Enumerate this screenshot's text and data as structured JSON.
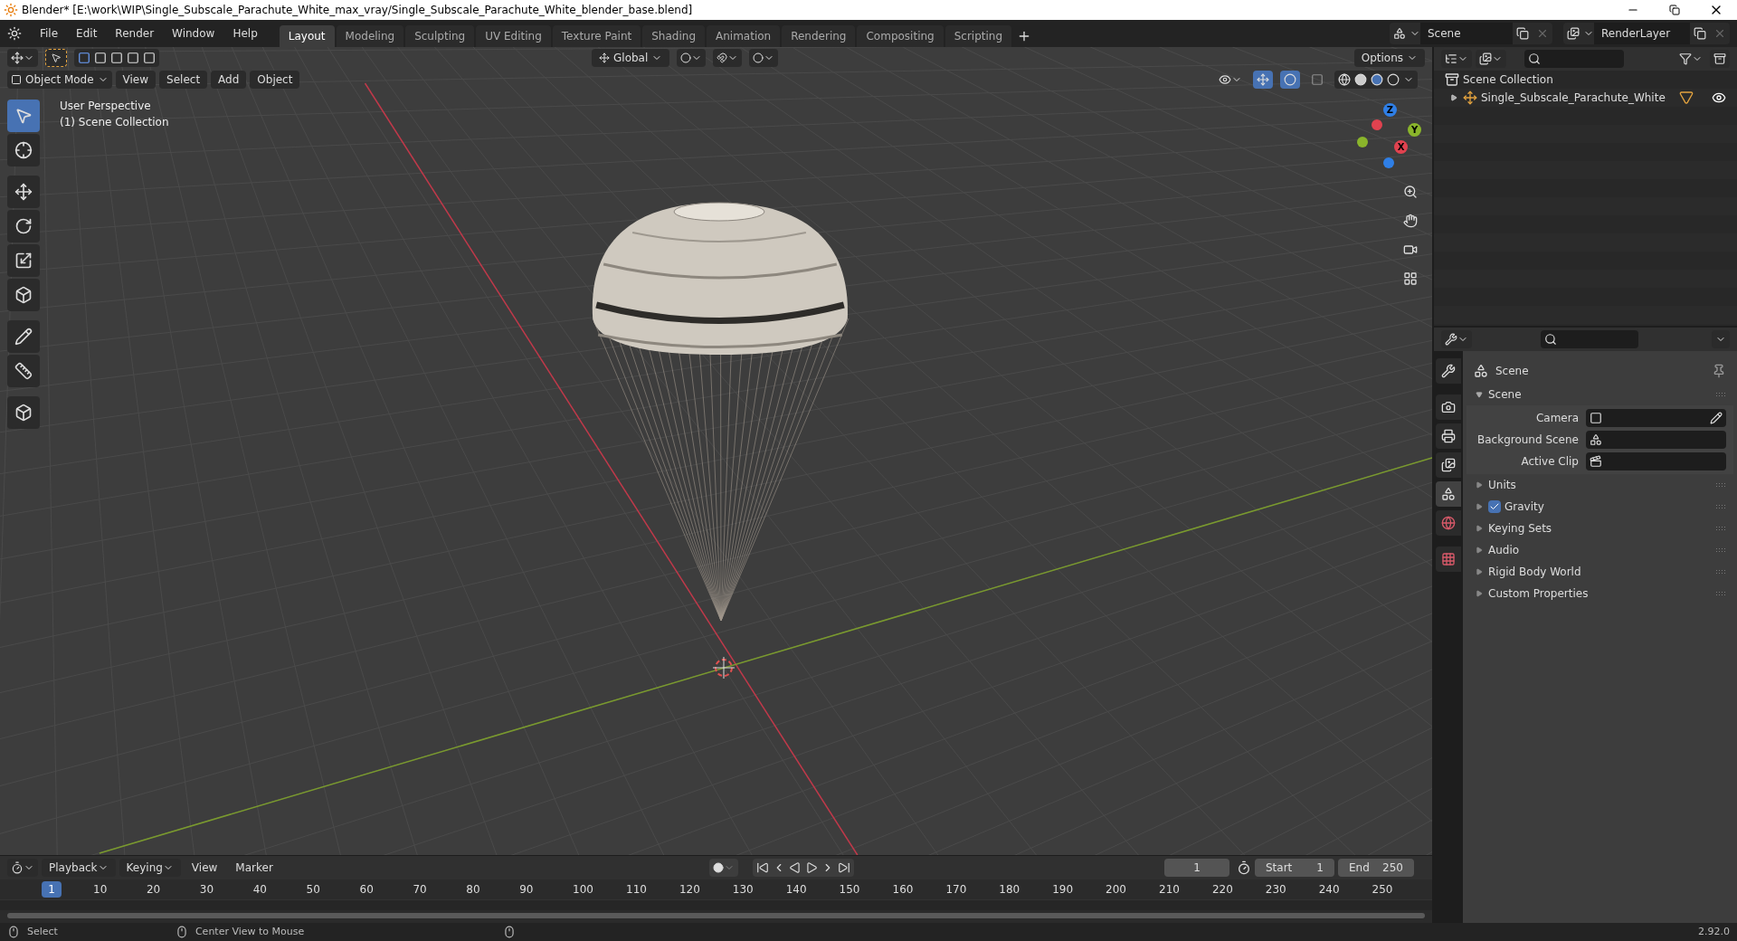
{
  "window": {
    "title": "Blender* [E:\\work\\WIP\\Single_Subscale_Parachute_White_max_vray/Single_Subscale_Parachute_White_blender_base.blend]"
  },
  "menu": [
    "File",
    "Edit",
    "Render",
    "Window",
    "Help"
  ],
  "workspaces": [
    {
      "label": "Layout",
      "selected": true
    },
    {
      "label": "Modeling",
      "selected": false
    },
    {
      "label": "Sculpting",
      "selected": false
    },
    {
      "label": "UV Editing",
      "selected": false
    },
    {
      "label": "Texture Paint",
      "selected": false
    },
    {
      "label": "Shading",
      "selected": false
    },
    {
      "label": "Animation",
      "selected": false
    },
    {
      "label": "Rendering",
      "selected": false
    },
    {
      "label": "Compositing",
      "selected": false
    },
    {
      "label": "Scripting",
      "selected": false
    }
  ],
  "scene_selector": {
    "value": "Scene"
  },
  "view_layer_selector": {
    "value": "RenderLayer"
  },
  "tool_header": {
    "orientation": "Global",
    "options": "Options"
  },
  "viewport_header": {
    "mode": "Object Mode",
    "menus": [
      "View",
      "Select",
      "Add",
      "Object"
    ]
  },
  "viewport": {
    "overlay_lines": [
      "User Perspective",
      "(1) Scene Collection"
    ],
    "gizmo_axes": [
      {
        "label": "Z",
        "color": "#2f7fe6"
      },
      {
        "label": "Y",
        "color": "#8ab52b"
      },
      {
        "label": "X",
        "color": "#e0424f"
      }
    ]
  },
  "toolbar": [
    {
      "kind": "select",
      "selected": true
    },
    {
      "kind": "cursor",
      "selected": false
    },
    {
      "kind": "move",
      "selected": false
    },
    {
      "kind": "rotate",
      "selected": false
    },
    {
      "kind": "scale",
      "selected": false
    },
    {
      "kind": "transform",
      "selected": false
    },
    {
      "kind": "annotate",
      "selected": false
    },
    {
      "kind": "measure",
      "selected": false
    },
    {
      "kind": "add_cube",
      "selected": false
    }
  ],
  "outliner": {
    "root": "Scene Collection",
    "items": [
      {
        "label": "Single_Subscale_Parachute_White",
        "expanded": false,
        "visible": true
      }
    ]
  },
  "properties": {
    "context": "Scene",
    "tabs": [
      {
        "kind": "tool",
        "selected": false
      },
      {
        "kind": "render",
        "selected": false
      },
      {
        "kind": "output",
        "selected": false
      },
      {
        "kind": "view_layer",
        "selected": false
      },
      {
        "kind": "scene",
        "selected": true
      },
      {
        "kind": "world",
        "selected": false
      },
      {
        "kind": "texture",
        "selected": false
      }
    ],
    "panels": [
      {
        "title": "Scene",
        "expanded": true,
        "fields": [
          {
            "label": "Camera",
            "kind": "camera"
          },
          {
            "label": "Background Scene",
            "kind": "scene"
          },
          {
            "label": "Active Clip",
            "kind": "clip"
          }
        ]
      },
      {
        "title": "Units",
        "expanded": false
      },
      {
        "title": "Gravity",
        "expanded": false,
        "checked": true
      },
      {
        "title": "Keying Sets",
        "expanded": false
      },
      {
        "title": "Audio",
        "expanded": false
      },
      {
        "title": "Rigid Body World",
        "expanded": false
      },
      {
        "title": "Custom Properties",
        "expanded": false
      }
    ]
  },
  "timeline": {
    "menus": [
      "Playback",
      "Keying",
      "View",
      "Marker"
    ],
    "current_frame": "1",
    "start_label": "Start",
    "start": "1",
    "end_label": "End",
    "end": "250",
    "ruler": [
      {
        "label": "1",
        "selected": true
      },
      {
        "label": "10",
        "selected": false
      },
      {
        "label": "20",
        "selected": false
      },
      {
        "label": "30",
        "selected": false
      },
      {
        "label": "40",
        "selected": false
      },
      {
        "label": "50",
        "selected": false
      },
      {
        "label": "60",
        "selected": false
      },
      {
        "label": "70",
        "selected": false
      },
      {
        "label": "80",
        "selected": false
      },
      {
        "label": "90",
        "selected": false
      },
      {
        "label": "100",
        "selected": false
      },
      {
        "label": "110",
        "selected": false
      },
      {
        "label": "120",
        "selected": false
      },
      {
        "label": "130",
        "selected": false
      },
      {
        "label": "140",
        "selected": false
      },
      {
        "label": "150",
        "selected": false
      },
      {
        "label": "160",
        "selected": false
      },
      {
        "label": "170",
        "selected": false
      },
      {
        "label": "180",
        "selected": false
      },
      {
        "label": "190",
        "selected": false
      },
      {
        "label": "200",
        "selected": false
      },
      {
        "label": "210",
        "selected": false
      },
      {
        "label": "220",
        "selected": false
      },
      {
        "label": "230",
        "selected": false
      },
      {
        "label": "240",
        "selected": false
      },
      {
        "label": "250",
        "selected": false
      }
    ]
  },
  "status_bar": {
    "hints": [
      "Select",
      "Center View to Mouse"
    ],
    "version": "2.92.0"
  }
}
